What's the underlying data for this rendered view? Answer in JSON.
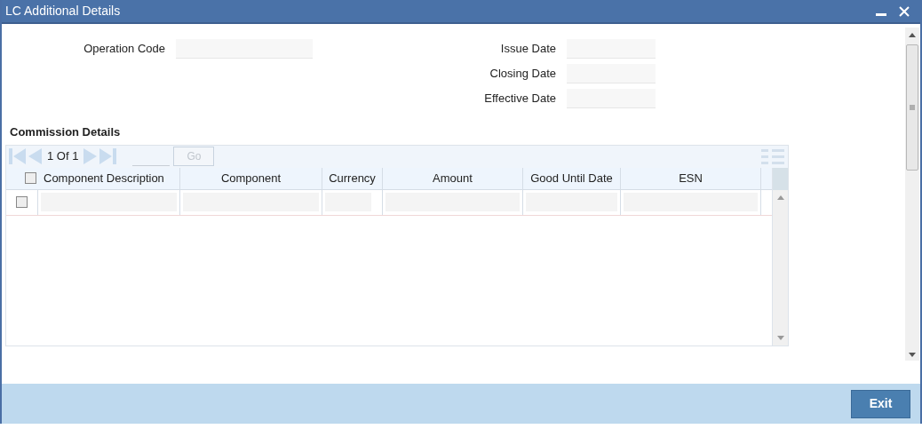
{
  "window": {
    "title": "LC Additional Details"
  },
  "left_fields": [
    {
      "label": "Operation Code"
    }
  ],
  "right_fields": [
    {
      "label": "Issue Date"
    },
    {
      "label": "Closing Date"
    },
    {
      "label": "Effective Date"
    }
  ],
  "commission": {
    "title": "Commission Details",
    "pagination": "1 Of 1",
    "go_button": "Go",
    "header_checked": false,
    "columns": [
      {
        "label": "Component Description"
      },
      {
        "label": "Component"
      },
      {
        "label": "Currency"
      },
      {
        "label": "Amount"
      },
      {
        "label": "Good Until Date"
      },
      {
        "label": "ESN"
      }
    ],
    "rows": [
      {
        "checked": false
      }
    ]
  },
  "footer": {
    "buttons": [
      "Exit"
    ]
  }
}
